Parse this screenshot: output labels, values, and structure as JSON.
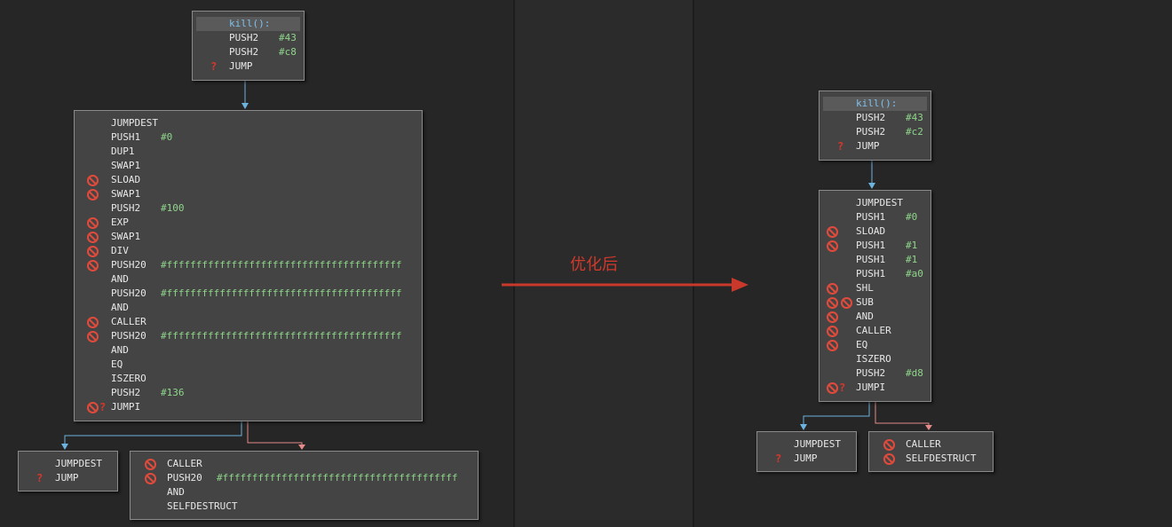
{
  "transition_label": "优化后",
  "before": {
    "entry": {
      "header": "kill():",
      "rows": [
        {
          "mn": "PUSH2",
          "arg": "#43",
          "icons": ""
        },
        {
          "mn": "PUSH2",
          "arg": "#c8",
          "icons": ""
        },
        {
          "mn": "JUMP",
          "arg": "",
          "icons": "q"
        }
      ]
    },
    "main": {
      "rows": [
        {
          "mn": "JUMPDEST",
          "arg": "",
          "icons": ""
        },
        {
          "mn": "PUSH1",
          "arg": "#0",
          "icons": ""
        },
        {
          "mn": "DUP1",
          "arg": "",
          "icons": ""
        },
        {
          "mn": "SWAP1",
          "arg": "",
          "icons": ""
        },
        {
          "mn": "SLOAD",
          "arg": "",
          "icons": "b"
        },
        {
          "mn": "SWAP1",
          "arg": "",
          "icons": "b"
        },
        {
          "mn": "PUSH2",
          "arg": "#100",
          "icons": ""
        },
        {
          "mn": "EXP",
          "arg": "",
          "icons": "b"
        },
        {
          "mn": "SWAP1",
          "arg": "",
          "icons": "b"
        },
        {
          "mn": "DIV",
          "arg": "",
          "icons": "b"
        },
        {
          "mn": "PUSH20",
          "arg": "#ffffffffffffffffffffffffffffffffffffffff",
          "icons": "b"
        },
        {
          "mn": "AND",
          "arg": "",
          "icons": ""
        },
        {
          "mn": "PUSH20",
          "arg": "#ffffffffffffffffffffffffffffffffffffffff",
          "icons": ""
        },
        {
          "mn": "AND",
          "arg": "",
          "icons": ""
        },
        {
          "mn": "CALLER",
          "arg": "",
          "icons": "b"
        },
        {
          "mn": "PUSH20",
          "arg": "#ffffffffffffffffffffffffffffffffffffffff",
          "icons": "b"
        },
        {
          "mn": "AND",
          "arg": "",
          "icons": ""
        },
        {
          "mn": "EQ",
          "arg": "",
          "icons": ""
        },
        {
          "mn": "ISZERO",
          "arg": "",
          "icons": ""
        },
        {
          "mn": "PUSH2",
          "arg": "#136",
          "icons": ""
        },
        {
          "mn": "JUMPI",
          "arg": "",
          "icons": "bq"
        }
      ]
    },
    "left_leaf": {
      "rows": [
        {
          "mn": "JUMPDEST",
          "arg": "",
          "icons": ""
        },
        {
          "mn": "JUMP",
          "arg": "",
          "icons": "q"
        }
      ]
    },
    "right_leaf": {
      "rows": [
        {
          "mn": "CALLER",
          "arg": "",
          "icons": "b"
        },
        {
          "mn": "PUSH20",
          "arg": "#ffffffffffffffffffffffffffffffffffffffff",
          "icons": "b"
        },
        {
          "mn": "AND",
          "arg": "",
          "icons": ""
        },
        {
          "mn": "SELFDESTRUCT",
          "arg": "",
          "icons": ""
        }
      ]
    }
  },
  "after": {
    "entry": {
      "header": "kill():",
      "rows": [
        {
          "mn": "PUSH2",
          "arg": "#43",
          "icons": ""
        },
        {
          "mn": "PUSH2",
          "arg": "#c2",
          "icons": ""
        },
        {
          "mn": "JUMP",
          "arg": "",
          "icons": "q"
        }
      ]
    },
    "main": {
      "rows": [
        {
          "mn": "JUMPDEST",
          "arg": "",
          "icons": ""
        },
        {
          "mn": "PUSH1",
          "arg": "#0",
          "icons": ""
        },
        {
          "mn": "SLOAD",
          "arg": "",
          "icons": "b"
        },
        {
          "mn": "PUSH1",
          "arg": "#1",
          "icons": "b"
        },
        {
          "mn": "PUSH1",
          "arg": "#1",
          "icons": ""
        },
        {
          "mn": "PUSH1",
          "arg": "#a0",
          "icons": ""
        },
        {
          "mn": "SHL",
          "arg": "",
          "icons": "b"
        },
        {
          "mn": "SUB",
          "arg": "",
          "icons": "bb"
        },
        {
          "mn": "AND",
          "arg": "",
          "icons": "b"
        },
        {
          "mn": "CALLER",
          "arg": "",
          "icons": "b"
        },
        {
          "mn": "EQ",
          "arg": "",
          "icons": "b"
        },
        {
          "mn": "ISZERO",
          "arg": "",
          "icons": ""
        },
        {
          "mn": "PUSH2",
          "arg": "#d8",
          "icons": ""
        },
        {
          "mn": "JUMPI",
          "arg": "",
          "icons": "bq"
        }
      ]
    },
    "left_leaf": {
      "rows": [
        {
          "mn": "JUMPDEST",
          "arg": "",
          "icons": ""
        },
        {
          "mn": "JUMP",
          "arg": "",
          "icons": "q"
        }
      ]
    },
    "right_leaf": {
      "rows": [
        {
          "mn": "CALLER",
          "arg": "",
          "icons": "b"
        },
        {
          "mn": "SELFDESTRUCT",
          "arg": "",
          "icons": "b"
        }
      ]
    }
  },
  "colors": {
    "background": "#262626",
    "block": "#444444",
    "true_edge": "#6db3e0",
    "false_edge": "#e48a8a",
    "arrow": "#c9392b",
    "argument": "#8fd58a",
    "warning": "#e24a3b"
  }
}
